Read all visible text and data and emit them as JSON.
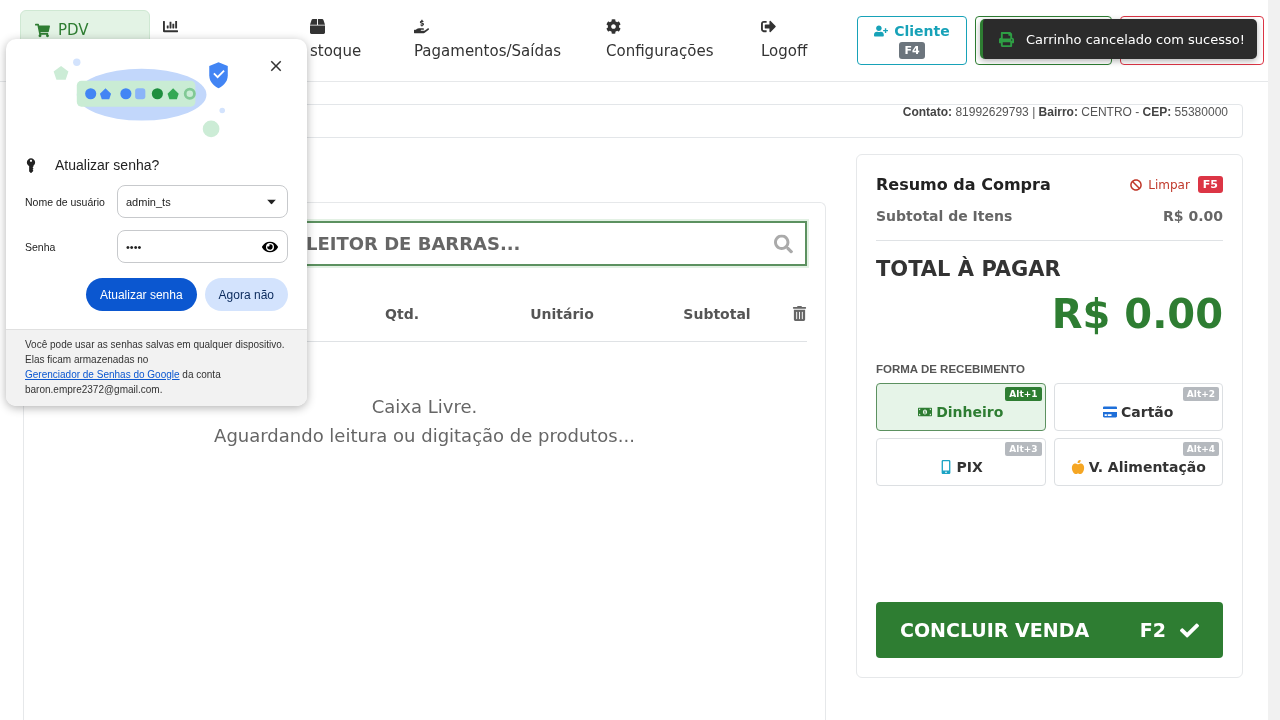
{
  "nav": {
    "tabs": [
      {
        "label": "PDV",
        "selected": true
      },
      {
        "selected": false
      },
      {
        "label": "stoque",
        "selected": false
      },
      {
        "label": "Pagamentos/Saídas",
        "selected": false
      },
      {
        "label": "Configurações",
        "selected": false
      },
      {
        "label": "Logoff",
        "selected": false
      }
    ]
  },
  "header_buttons": [
    {
      "kind": "client",
      "label": "Cliente",
      "shortcut": "F4"
    },
    {
      "kind": "confirm"
    },
    {
      "kind": "cancel"
    }
  ],
  "toast": {
    "message": "Carrinho cancelado com sucesso!"
  },
  "customer_info": "**Contato:** 81992629793 | **Bairro:** CENTRO - **CEP:** 55380000",
  "cart": {
    "search": {
      "placeholder": "LEITOR DE BARRAS..."
    },
    "columns": [
      "Qtd.",
      "Unitário",
      "Subtotal"
    ],
    "empty_title": "Caixa Livre.",
    "empty_message": "Aguardando leitura ou digitação de produtos..."
  },
  "summary": {
    "title": "Resumo da Compra",
    "clear_label": "Limpar",
    "clear_shortcut": "F5",
    "subtotal_label": "Subtotal de Itens",
    "subtotal_value": "R$ 0.00",
    "total_label": "TOTAL À PAGAR",
    "total_value": "R$ 0.00",
    "payment_heading": "FORMA DE RECEBIMENTO",
    "payment_methods": [
      {
        "label": "Dinheiro",
        "shortcut": "Alt+1",
        "selected": true
      },
      {
        "label": "Cartão",
        "shortcut": "Alt+2",
        "selected": false
      },
      {
        "label": "PIX",
        "shortcut": "Alt+3",
        "selected": false
      },
      {
        "label": "V. Alimentação",
        "shortcut": "Alt+4",
        "selected": false
      }
    ],
    "finish": {
      "label": "CONCLUIR VENDA",
      "shortcut": "F2"
    }
  },
  "password_popup": {
    "title": "Atualizar senha?",
    "fields": [
      {
        "kind": "select",
        "label": "Nome de usuário",
        "value": "admin_ts"
      },
      {
        "kind": "password",
        "label": "Senha",
        "value": "••••"
      }
    ],
    "primary_button": "Atualizar senha",
    "secondary_button": "Agora não",
    "footer_before": "Você pode usar as senhas salvas em qualquer dispositivo. Elas ficam armazenadas no",
    "footer_link": "Gerenciador de Senhas do Google",
    "footer_after": "da conta baron.empre2372@gmail.com."
  }
}
